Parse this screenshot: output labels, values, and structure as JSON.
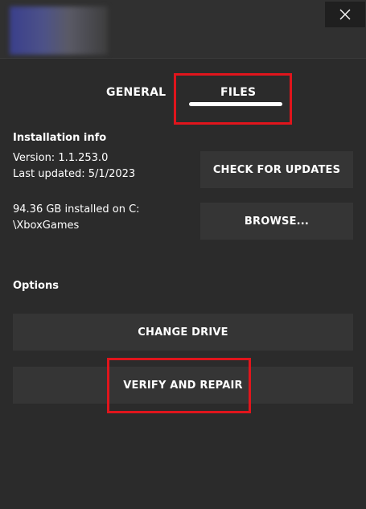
{
  "header": {
    "close_icon": "close-icon"
  },
  "tabs": [
    {
      "label": "GENERAL",
      "active": false
    },
    {
      "label": "FILES",
      "active": true
    }
  ],
  "installation": {
    "title": "Installation info",
    "version": "Version: 1.1.253.0",
    "last_updated": "Last updated: 5/1/2023",
    "size_line1": "94.36 GB installed on C:",
    "size_line2": "\\XboxGames",
    "check_updates_label": "CHECK FOR UPDATES",
    "browse_label": "BROWSE..."
  },
  "options": {
    "title": "Options",
    "change_drive_label": "CHANGE DRIVE",
    "verify_repair_label": "VERIFY AND REPAIR"
  },
  "colors": {
    "background": "#2b2b2b",
    "button": "#353535",
    "highlight": "#e0151c"
  }
}
